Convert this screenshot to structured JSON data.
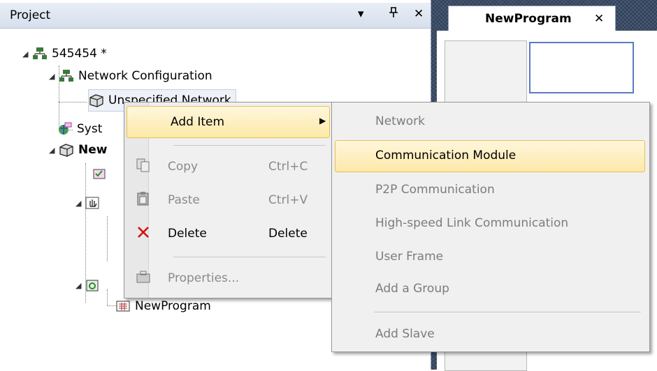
{
  "panel": {
    "title": "Project",
    "dropdown_glyph": "▾",
    "pin_glyph": "ꟸ",
    "close_glyph": "✕"
  },
  "tree": {
    "root": "545454 *",
    "network_config": "Network Configuration",
    "unspecified_network": "Unspecified Network",
    "sys_partial": "Syst",
    "new_partial": "New",
    "newprogram": "NewProgram"
  },
  "tab": {
    "label": "NewProgram",
    "close_glyph": "✕"
  },
  "context_menu": {
    "add_item": "Add Item",
    "add_item_arrow": "▶",
    "copy": "Copy",
    "copy_shortcut": "Ctrl+C",
    "paste": "Paste",
    "paste_shortcut": "Ctrl+V",
    "delete": "Delete",
    "delete_shortcut": "Delete",
    "properties": "Properties..."
  },
  "submenu": {
    "items": [
      "Network",
      "Communication Module",
      "P2P Communication",
      "High-speed Link Communication",
      "User Frame",
      "Add a Group",
      "Add Slave"
    ]
  },
  "colors": {
    "highlight_border": "#e6bf57",
    "highlight_fill": "#fde8a8",
    "editor_bg": "#2c3e58",
    "selection_border": "#5c7ac2",
    "delete_icon": "#d01010"
  },
  "icons": {
    "copy": "copy-icon",
    "paste": "paste-icon",
    "delete": "delete-x-icon",
    "properties": "properties-icon",
    "network": "network-icon",
    "module": "module-icon",
    "program": "program-icon"
  }
}
